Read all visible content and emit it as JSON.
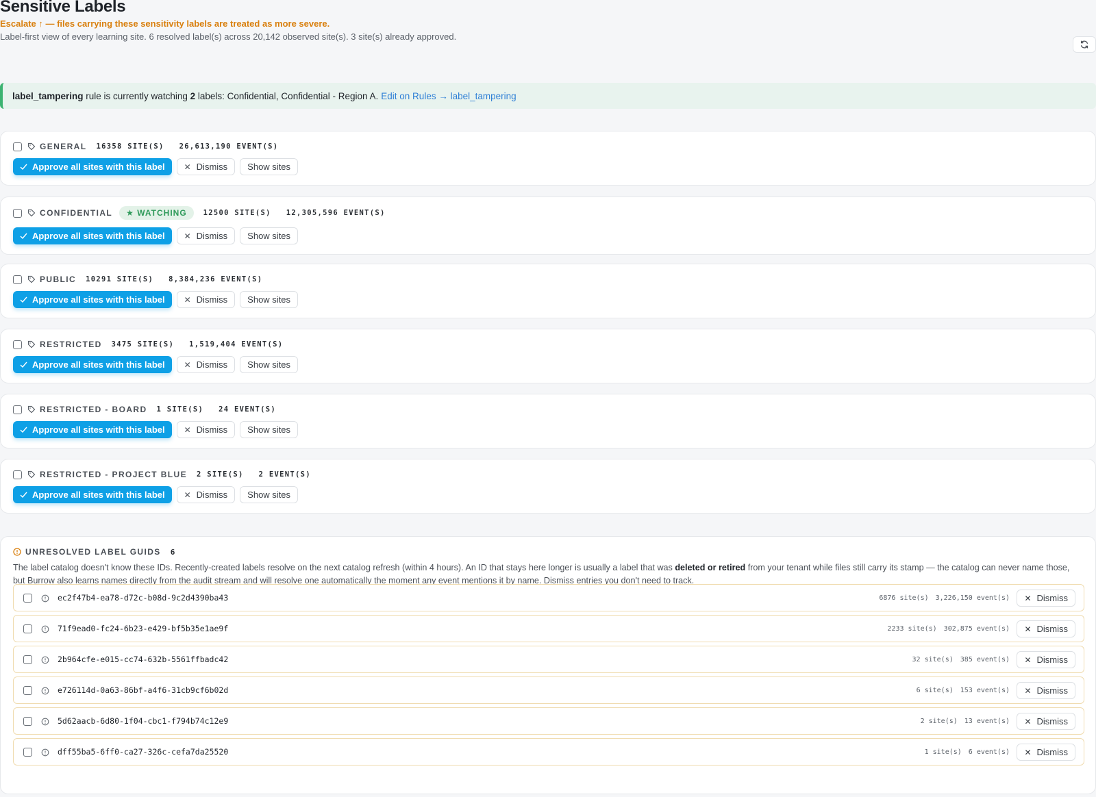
{
  "header": {
    "title": "Sensitive Labels",
    "subtitle": "Escalate ↑ — files carrying these sensitivity labels are treated as more severe.",
    "description": "Label-first view of every learning site. 6 resolved label(s) across 20,142 observed site(s). 3 site(s) already approved."
  },
  "banner": {
    "rule": "label_tampering",
    "text_mid": " rule is currently watching ",
    "count": "2",
    "text_end": " labels: Confidential, Confidential - Region A.",
    "link": "Edit on Rules → label_tampering"
  },
  "actions": {
    "approve": "Approve all sites with this label",
    "dismiss": "Dismiss",
    "show_sites": "Show sites"
  },
  "labels": [
    {
      "name": "GENERAL",
      "sites": "16358 SITE(S)",
      "events": "26,613,190 EVENT(S)",
      "watching": ""
    },
    {
      "name": "CONFIDENTIAL",
      "sites": "12500 SITE(S)",
      "events": "12,305,596 EVENT(S)",
      "watching": "★ WATCHING"
    },
    {
      "name": "PUBLIC",
      "sites": "10291 SITE(S)",
      "events": "8,384,236 EVENT(S)",
      "watching": ""
    },
    {
      "name": "RESTRICTED",
      "sites": "3475 SITE(S)",
      "events": "1,519,404 EVENT(S)",
      "watching": ""
    },
    {
      "name": "RESTRICTED - BOARD",
      "sites": "1 SITE(S)",
      "events": "24 EVENT(S)",
      "watching": ""
    },
    {
      "name": "RESTRICTED - PROJECT BLUE",
      "sites": "2 SITE(S)",
      "events": "2 EVENT(S)",
      "watching": ""
    }
  ],
  "unresolved": {
    "title": "UNRESOLVED LABEL GUIDS",
    "count": "6",
    "desc_a": "The label catalog doesn't know these IDs. Recently-created labels resolve on the next catalog refresh (within 4 hours). An ID that stays here longer is usually a label that was ",
    "desc_b": "deleted or retired",
    "desc_c": " from your tenant while files still carry its stamp — the catalog can never name those, but Burrow also learns names directly from the audit stream and will resolve one automatically the moment any event mentions it by name. Dismiss entries you don't need to track.",
    "dismiss": "Dismiss",
    "rows": [
      {
        "id": "ec2f47b4-ea78-d72c-b08d-9c2d4390ba43",
        "sites": "6876 site(s)",
        "events": "3,226,150 event(s)"
      },
      {
        "id": "71f9ead0-fc24-6b23-e429-bf5b35e1ae9f",
        "sites": "2233 site(s)",
        "events": "302,875 event(s)"
      },
      {
        "id": "2b964cfe-e015-cc74-632b-5561ffbadc42",
        "sites": "32 site(s)",
        "events": "385 event(s)"
      },
      {
        "id": "e726114d-0a63-86bf-a4f6-31cb9cf6b02d",
        "sites": "6 site(s)",
        "events": "153 event(s)"
      },
      {
        "id": "5d62aacb-6d80-1f04-cbc1-f794b74c12e9",
        "sites": "2 site(s)",
        "events": "13 event(s)"
      },
      {
        "id": "dff55ba5-6ff0-ca27-326c-cefa7da25520",
        "sites": "1 site(s)",
        "events": "6 event(s)"
      }
    ]
  },
  "colors": {
    "accent": "#0ea0e6",
    "warning": "#d9800f",
    "watching": "#2f9a5a",
    "link": "#2e7fd6"
  }
}
